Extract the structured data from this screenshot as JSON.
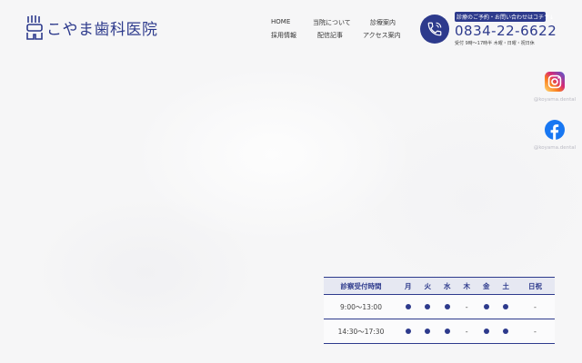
{
  "clinic": {
    "name": "こやま歯科医院"
  },
  "nav": {
    "items": [
      {
        "label": "HOME"
      },
      {
        "label": "当院について"
      },
      {
        "label": "診療案内"
      },
      {
        "label": "採用情報"
      },
      {
        "label": "配信記事"
      },
      {
        "label": "アクセス案内"
      }
    ]
  },
  "contact": {
    "caption": "診療のご予約・お問い合わせはコチラ↓",
    "phone": "0834-22-6622",
    "hours": "受付 9時〜17時半 木曜・日曜・祝日休"
  },
  "social": {
    "instagram": {
      "handle": "@koyama.dental",
      "icon": "instagram-icon"
    },
    "facebook": {
      "handle": "@koyama.dental",
      "icon": "facebook-icon"
    }
  },
  "schedule": {
    "header": [
      "診察受付時間",
      "月",
      "火",
      "水",
      "木",
      "金",
      "土",
      "日祝"
    ],
    "rows": [
      {
        "time": "9:00〜13:00",
        "days": [
          "●",
          "●",
          "●",
          "-",
          "●",
          "●",
          "-"
        ]
      },
      {
        "time": "14:30〜17:30",
        "days": [
          "●",
          "●",
          "●",
          "-",
          "●",
          "●",
          "-"
        ]
      }
    ]
  },
  "colors": {
    "brand": "#2d3a8c",
    "instagram": "#e1306c",
    "facebook": "#1877f2"
  }
}
